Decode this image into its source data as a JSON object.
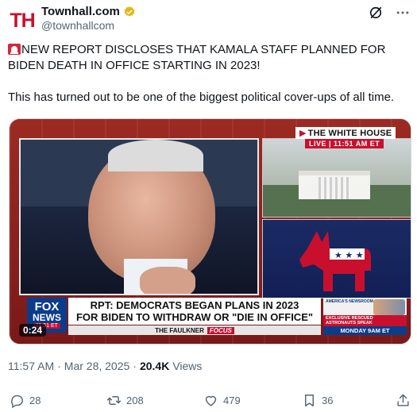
{
  "author": {
    "avatar_text": "TH",
    "display_name": "Townhall.com",
    "handle": "@townhallcom"
  },
  "post": {
    "line1": "NEW REPORT DISCLOSES THAT KAMALA STAFF PLANNED FOR BIDEN DEATH IN OFFICE STARTING IN 2023!",
    "line2": "This has turned out to be one of the biggest political cover-ups of all time."
  },
  "video": {
    "location_label": "THE WHITE HOUSE",
    "live_label": "LIVE | 11:51 AM ET",
    "network_top": "FOX",
    "network_bottom": "NEWS",
    "network_time": "11:51 ET",
    "headline_line1": "RPT: DEMOCRATS BEGAN PLANS IN 2023",
    "headline_line2": "FOR BIDEN TO WITHDRAW OR \"DIE IN OFFICE\"",
    "show_name": "THE FAULKNER",
    "show_tag": "FOCUS",
    "promo_brand": "AMERICA'S NEWSROOM",
    "promo_exclusive": "EXCLUSIVE RESCUED ASTRONAUTS SPEAK",
    "promo_time": "MONDAY 9AM ET",
    "duration": "0:24"
  },
  "meta": {
    "time": "11:57 AM",
    "separator": "·",
    "date": "Mar 28, 2025",
    "separator2": "·",
    "views_count": "20.4K",
    "views_label": "Views"
  },
  "actions": {
    "replies": "28",
    "reposts": "208",
    "likes": "479",
    "bookmarks": "36"
  },
  "colors": {
    "brand_red": "#c8102e",
    "text": "#0f1419",
    "muted": "#536471",
    "verified_gold": "#e2b719"
  }
}
